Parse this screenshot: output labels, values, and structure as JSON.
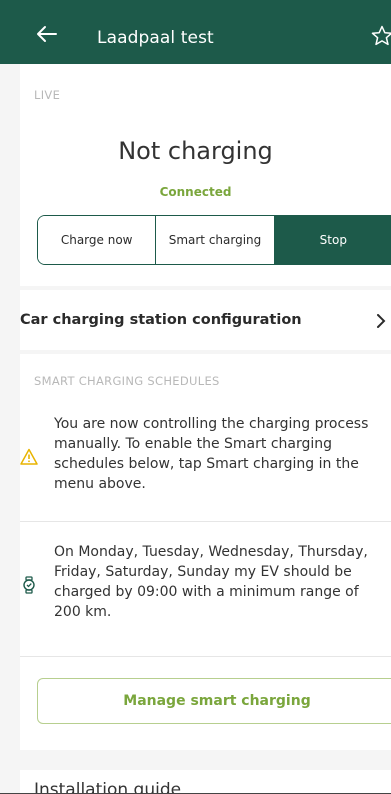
{
  "topbar": {
    "back_icon": "arrow-left-icon",
    "title": "Laadpaal test",
    "favorite_icon": "star-outline-icon"
  },
  "live": {
    "section_label": "LIVE",
    "status_title": "Not charging",
    "status_sub": "Connected",
    "segments": [
      {
        "label": "Charge now",
        "active": false
      },
      {
        "label": "Smart charging",
        "active": false
      },
      {
        "label": "Stop",
        "active": true
      }
    ]
  },
  "config": {
    "label": "Car charging station configuration",
    "chevron_icon": "chevron-right-icon"
  },
  "schedules": {
    "section_label": "SMART CHARGING SCHEDULES",
    "items": [
      {
        "icon": "warning-icon",
        "text": "You are now controlling the charging process manually. To enable the Smart charging schedules below, tap Smart charging in the menu above."
      },
      {
        "icon": "watch-icon",
        "text": "On Monday, Tuesday, Wednesday, Thursday, Friday, Saturday, Sunday my EV should be charged by 09:00 with a minimum range of 200 km."
      }
    ],
    "manage_label": "Manage smart charging"
  },
  "install": {
    "label": "Installation guide"
  },
  "colors": {
    "brand": "#1d5a4a",
    "accent_green": "#7aa63c",
    "warning": "#e8b400"
  }
}
